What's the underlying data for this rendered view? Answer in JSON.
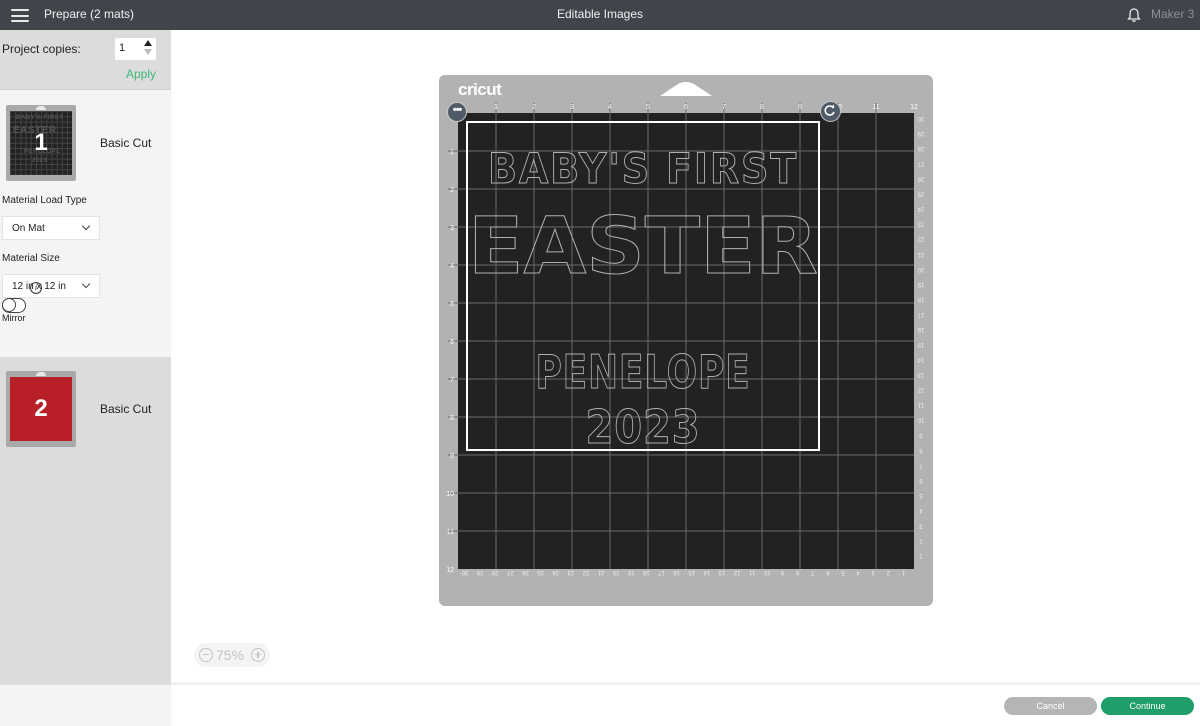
{
  "header": {
    "menu_icon": "hamburger-icon",
    "title": "Prepare (2 mats)",
    "center_title": "Editable Images",
    "notification_icon": "bell-icon",
    "machine": "Maker 3"
  },
  "sidebar": {
    "project_copies_label": "Project copies:",
    "project_copies_value": "1",
    "apply_label": "Apply",
    "mats": [
      {
        "number": "1",
        "label": "Basic Cut",
        "color": "#222222",
        "selected": true
      },
      {
        "number": "2",
        "label": "Basic Cut",
        "color": "#b91f27",
        "selected": false
      }
    ],
    "material_load_type_label": "Material Load Type",
    "material_load_type_value": "On Mat",
    "material_size_label": "Material Size",
    "material_size_value": "12 in x 12 in",
    "mirror_label": "Mirror",
    "mirror_on": false
  },
  "mat": {
    "brand": "cricut",
    "top_ruler": [
      "1",
      "2",
      "3",
      "4",
      "5",
      "6",
      "7",
      "8",
      "9",
      "10",
      "11",
      "12"
    ],
    "left_ruler": [
      "1",
      "2",
      "3",
      "4",
      "5",
      "6",
      "7",
      "8",
      "9",
      "10",
      "11",
      "12"
    ],
    "bottom_ruler_cm": [
      "30",
      "29",
      "28",
      "27",
      "26",
      "25",
      "24",
      "23",
      "22",
      "21",
      "20",
      "19",
      "18",
      "17",
      "16",
      "15",
      "14",
      "13",
      "12",
      "11",
      "10",
      "9",
      "8",
      "7",
      "6",
      "5",
      "4",
      "3",
      "2",
      "1"
    ],
    "right_ruler_cm": [
      "30",
      "29",
      "28",
      "27",
      "26",
      "25",
      "24",
      "23",
      "22",
      "21",
      "20",
      "19",
      "18",
      "17",
      "16",
      "15",
      "14",
      "13",
      "12",
      "11",
      "10",
      "9",
      "8",
      "7",
      "6",
      "5",
      "4",
      "3",
      "2",
      "1"
    ],
    "design_lines": [
      "BABY'S FIRST",
      "EASTER",
      "PENELOPE",
      "2023"
    ],
    "more_icon": "ellipsis-icon",
    "rotate_icon": "rotate-icon"
  },
  "zoom": {
    "value": "75%",
    "minus_icon": "zoom-out-icon",
    "plus_icon": "zoom-in-icon"
  },
  "footer": {
    "cancel_label": "Cancel",
    "continue_label": "Continue"
  },
  "colors": {
    "topbar": "#40454c",
    "accent_green": "#1f9e6a",
    "apply_green": "#3fb87a",
    "mat_frame": "#b2b2b2",
    "mat_surface": "#222222",
    "mat2_color": "#b91f27"
  }
}
